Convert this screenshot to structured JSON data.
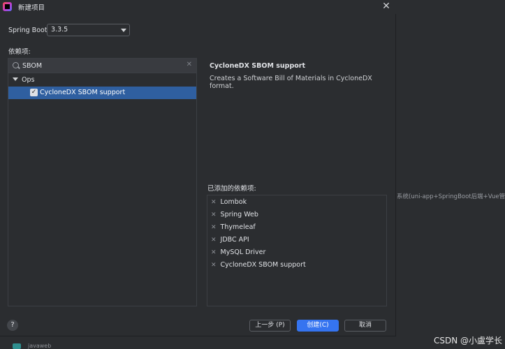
{
  "window": {
    "title": "新建项目"
  },
  "spring_boot": {
    "label": "Spring Boot:",
    "value": "3.3.5"
  },
  "dependencies": {
    "label": "依赖项:",
    "search_value": "SBOM",
    "group": "Ops",
    "item": "CycloneDX SBOM support"
  },
  "info": {
    "title": "CycloneDX SBOM support",
    "description": "Creates a Software Bill of Materials in CycloneDX format."
  },
  "added": {
    "label": "已添加的依赖项:",
    "items": [
      "Lombok",
      "Spring Web",
      "Thymeleaf",
      "JDBC API",
      "MySQL Driver",
      "CycloneDX SBOM support"
    ]
  },
  "buttons": {
    "help": "?",
    "previous": "上一步 (P)",
    "create": "创建(C)",
    "cancel": "取消"
  },
  "background": {
    "snippet": "系统(uni-app+SpringBoot后端+Vue管理",
    "bottom_label": "javaweb",
    "watermark": "CSDN @小盧学长"
  }
}
